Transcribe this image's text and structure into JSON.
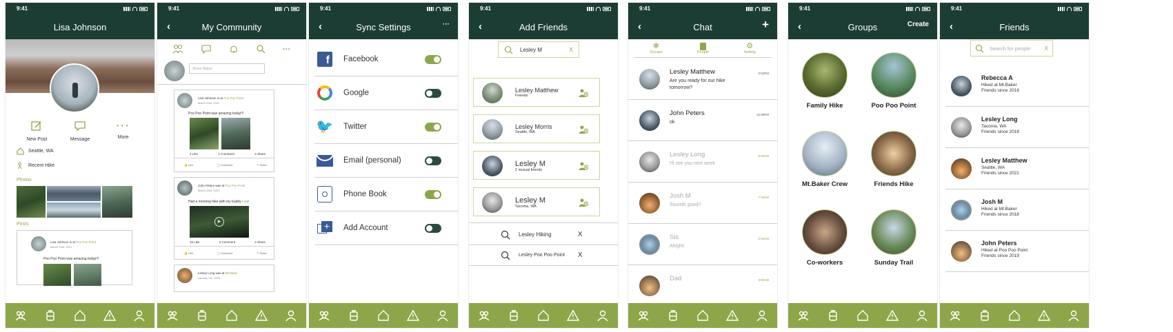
{
  "colors": {
    "dark": "#1c3d34",
    "accent": "#8ea64a"
  },
  "status_time": "9:41",
  "tabbar_icons": [
    "community-icon",
    "backpack-icon",
    "home-icon",
    "alert-icon",
    "profile-icon"
  ],
  "s1": {
    "title": "Lisa Johnson",
    "actions": [
      {
        "label": "New Post"
      },
      {
        "label": "Message"
      },
      {
        "label": "More"
      }
    ],
    "location": "Seattle, WA",
    "recent": "Recent Hike",
    "photos_label": "Photos",
    "posts_label": "Posts",
    "post": {
      "author": "Lisa Johnson is at",
      "place": "Poo Poo Point",
      "date": "March 23rd, 2021",
      "text": "Poo Poo Point was amazing today!!!"
    }
  },
  "s2": {
    "title": "My Community",
    "status_placeholder": "Share Status",
    "posts": [
      {
        "author": "Lisa Johnson is at",
        "place": "Poo Poo Point",
        "date": "March 23rd, 2021",
        "text": "Poo Poo Point was amazing today!!!",
        "counts": [
          "2 Like",
          "1 Comment",
          "4 Share"
        ],
        "actions": [
          "Like",
          "Comment",
          "Share"
        ]
      },
      {
        "author": "John Peters was at",
        "place": "Poo Poo Point",
        "date": "March 23rd, 2021",
        "text": "Had a morning hike with my buddy",
        "tag": "Lisa!",
        "counts": [
          "10 Like",
          "2 Comment",
          "4 Share"
        ],
        "actions": [
          "Like",
          "Comment",
          "Share"
        ]
      },
      {
        "author": "Lesley Long was at",
        "place": "Mt.Baker",
        "date": "January 3rd, 2021"
      }
    ]
  },
  "s3": {
    "title": "Sync Settings",
    "more": "···",
    "items": [
      {
        "label": "Facebook",
        "on": true,
        "icon": "facebook-icon"
      },
      {
        "label": "Google",
        "on": false,
        "icon": "google-icon"
      },
      {
        "label": "Twitter",
        "on": true,
        "icon": "twitter-icon"
      },
      {
        "label": "Email (personal)",
        "on": false,
        "icon": "email-icon"
      },
      {
        "label": "Phone Book",
        "on": true,
        "icon": "phonebook-icon"
      },
      {
        "label": "Add Account",
        "on": false,
        "icon": "add-account-icon"
      }
    ]
  },
  "s4": {
    "title": "Add Friends",
    "search_value": "Lesley M",
    "clear": "X",
    "results": [
      {
        "name": "Lesley Matthew",
        "sub": "Friends"
      },
      {
        "name": "Lesley Morris",
        "sub": "Seattle, WA"
      },
      {
        "name": "Lesley M",
        "sub": "2 mutual friends"
      },
      {
        "name": "Lesley M",
        "sub": "Tacoma, WA"
      }
    ],
    "recent": [
      {
        "label": "Lesley Hiking",
        "x": "X"
      },
      {
        "label": "Lesley Poo Poo Point",
        "x": "X"
      }
    ]
  },
  "s5": {
    "title": "Chat",
    "plus": "+",
    "tabs": [
      "Groups",
      "People",
      "Setting"
    ],
    "chats": [
      {
        "name": "Lesley Matthew",
        "msg": "Are you ready for our hike tomorrow?",
        "time": "2:01PM",
        "read": false
      },
      {
        "name": "John Peters",
        "msg": "ok",
        "time": "12:00PM",
        "read": false
      },
      {
        "name": "Lesley Long",
        "msg": "I'll see you next week",
        "time": "9:00AM",
        "read": true
      },
      {
        "name": "Josh M",
        "msg": "Sounds good!!",
        "time": "7:15AM",
        "read": true
      },
      {
        "name": "Sis",
        "msg": "Alright!",
        "time": "2:45AM",
        "read": true
      },
      {
        "name": "Dad",
        "msg": "",
        "time": "9:00AM",
        "read": true
      }
    ]
  },
  "s6": {
    "title": "Groups",
    "create": "Create",
    "groups": [
      "Family Hike",
      "Poo Poo Point",
      "Mt.Baker Crew",
      "Friends Hike",
      "Co-workers",
      "Sunday Trail"
    ]
  },
  "s7": {
    "title": "Friends",
    "search_placeholder": "Search for people",
    "clear": "X",
    "friends": [
      {
        "name": "Rebecca A",
        "l1": "Hiked at Mt.Baker",
        "l2": "Friends since 2018"
      },
      {
        "name": "Lesley Long",
        "l1": "Tacoma, WA",
        "l2": "Friends since 2018"
      },
      {
        "name": "Lesley Matthew",
        "l1": "Seattle, WA",
        "l2": "Friends since 2021"
      },
      {
        "name": "Josh M",
        "l1": "Hiked at Mt.Baker",
        "l2": "Friends since 2018"
      },
      {
        "name": "John Peters",
        "l1": "Hiked at Poo Poo Point",
        "l2": "Friends since 2019"
      }
    ]
  }
}
